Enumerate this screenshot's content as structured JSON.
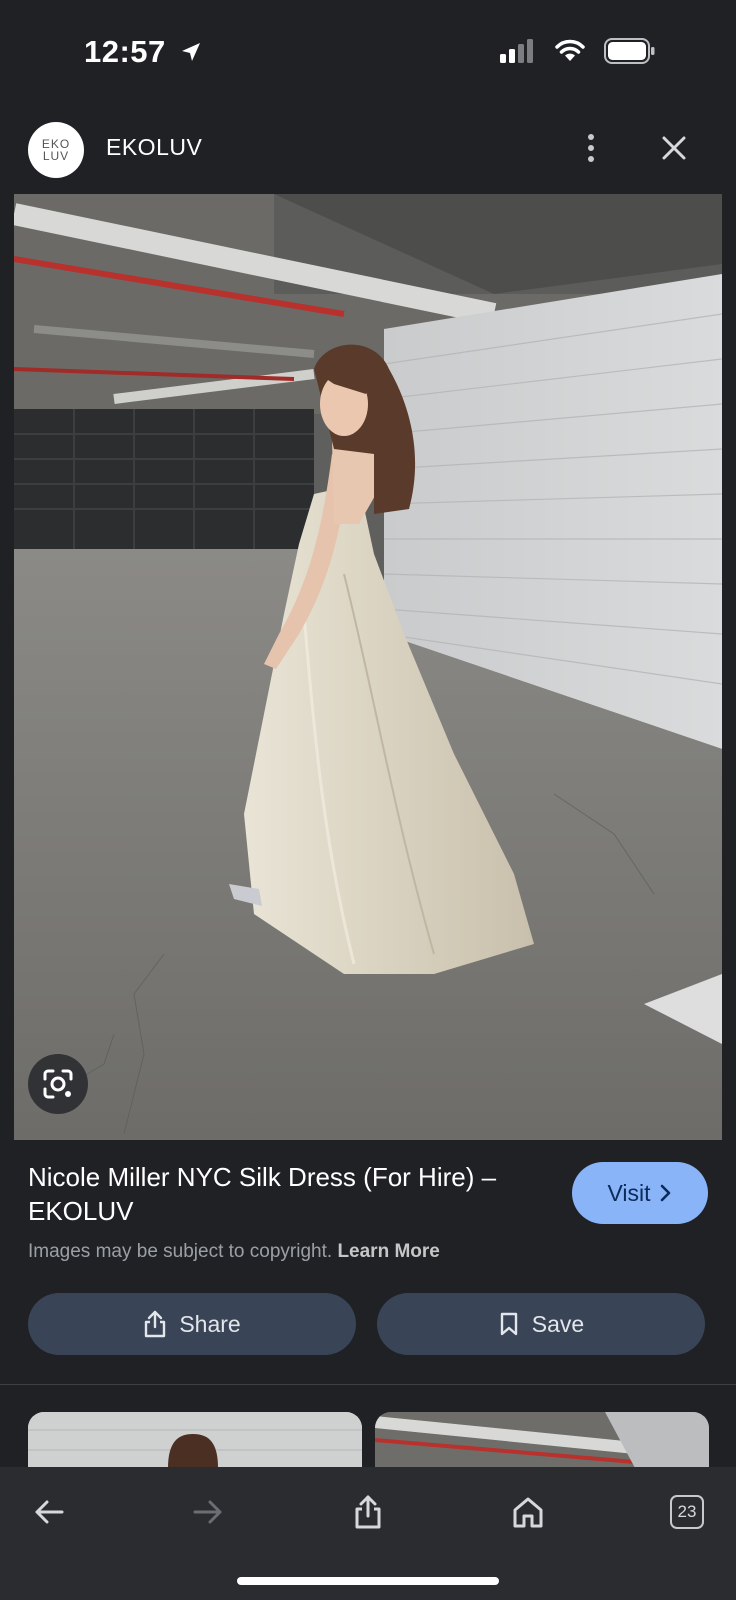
{
  "status_bar": {
    "time": "12:57"
  },
  "header": {
    "logo_text_line1": "EKO",
    "logo_text_line2": "LUV",
    "site_name": "EKOLUV"
  },
  "result": {
    "title": "Nicole Miller NYC Silk Dress (For Hire) – EKOLUV",
    "visit_label": "Visit",
    "copyright_text": "Images may be subject to copyright.",
    "learn_more_label": "Learn More"
  },
  "actions": {
    "share_label": "Share",
    "save_label": "Save"
  },
  "bottom_bar": {
    "tab_count": "23"
  },
  "icons": {
    "location": "location-arrow-icon",
    "signal": "cellular-signal-icon",
    "wifi": "wifi-icon",
    "battery": "battery-icon",
    "more": "more-vertical-icon",
    "close": "close-icon",
    "lens": "google-lens-icon",
    "share": "share-icon",
    "bookmark": "bookmark-icon",
    "back": "back-arrow-icon",
    "forward": "forward-arrow-icon",
    "home": "home-icon"
  },
  "colors": {
    "background": "#1f2125",
    "visit_button": "#8ab4f8",
    "action_button": "#394457"
  }
}
